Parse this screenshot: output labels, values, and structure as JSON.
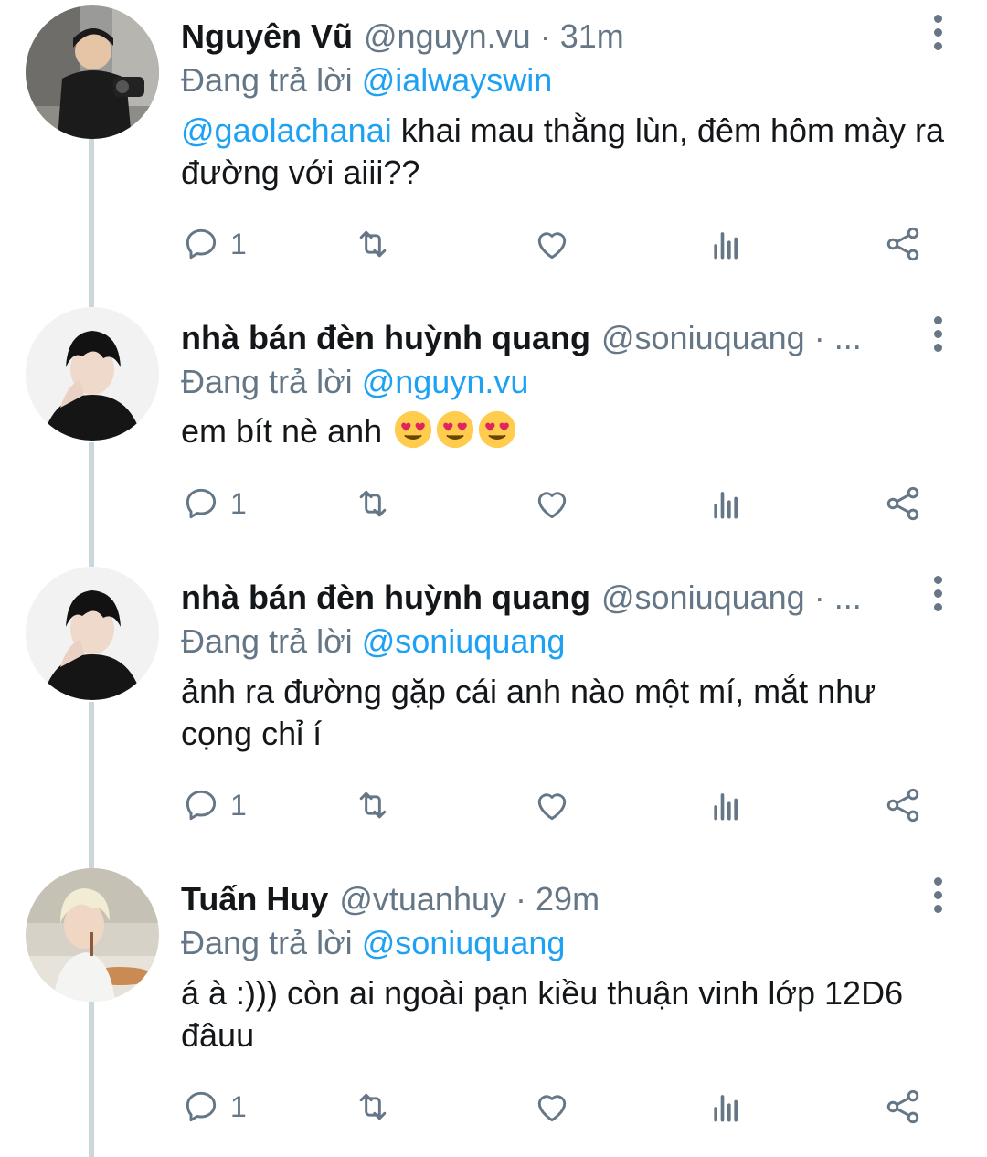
{
  "tweets": [
    {
      "name": "Nguyên Vũ",
      "handle": "@nguyn.vu",
      "separator": "·",
      "time": "31m",
      "replying_prefix": "Đang trả lời",
      "replying_to": "@ialwayswin",
      "mention": "@gaolachanai",
      "text": " khai mau thằng lùn, đêm hôm mày ra đường với aiii??",
      "reply_count": "1"
    },
    {
      "name": "nhà bán đèn huỳnh quang",
      "handle": "@soniuquang",
      "separator": "·",
      "time": "...",
      "replying_prefix": "Đang trả lời",
      "replying_to": "@nguyn.vu",
      "text": "em bít nè anh ",
      "emoji": [
        "heart-eyes",
        "heart-eyes",
        "heart-eyes"
      ],
      "reply_count": "1"
    },
    {
      "name": "nhà bán đèn huỳnh quang",
      "handle": "@soniuquang",
      "separator": "·",
      "time": "...",
      "replying_prefix": "Đang trả lời",
      "replying_to": "@soniuquang",
      "text": "ảnh ra đường gặp cái anh nào một mí, mắt như cọng chỉ í",
      "reply_count": "1"
    },
    {
      "name": "Tuấn Huy",
      "handle": "@vtuanhuy",
      "separator": "·",
      "time": "29m",
      "replying_prefix": "Đang trả lời",
      "replying_to": "@soniuquang",
      "text": "á à :))) còn ai ngoài pạn kiều thuận vinh lớp 12D6 đâuu",
      "reply_count": "1"
    }
  ],
  "icons": [
    "reply-icon",
    "retweet-icon",
    "like-icon",
    "views-icon",
    "share-icon",
    "more-icon"
  ],
  "colors": {
    "link": "#1da1f2",
    "secondary": "#657786",
    "text": "#14171a",
    "thread_line": "#ccd6dd"
  }
}
